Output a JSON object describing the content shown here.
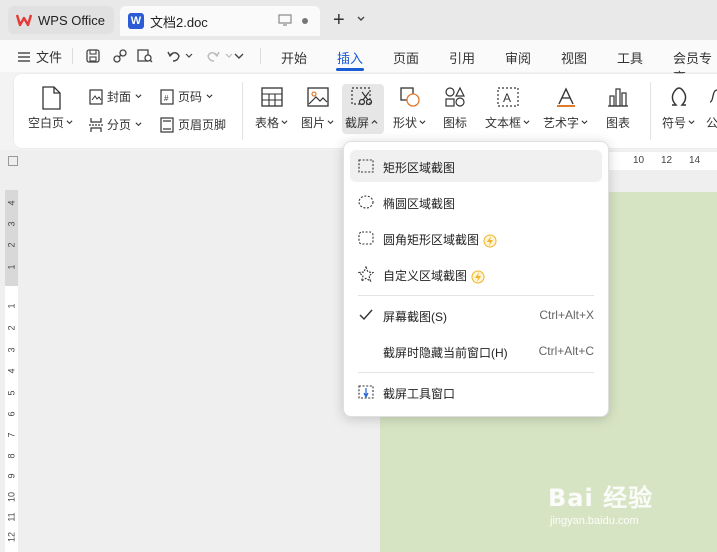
{
  "tabs": {
    "app_tab": "WPS Office",
    "doc_tab": "文档2.doc"
  },
  "menubar": {
    "file": "文件",
    "tabs": [
      "开始",
      "插入",
      "页面",
      "引用",
      "审阅",
      "视图",
      "工具",
      "会员专享"
    ],
    "active_tab": "插入"
  },
  "ribbon": {
    "blank_page": "空白页",
    "cover": "封面",
    "page_break": "分页",
    "page_number": "页码",
    "header_footer": "页眉页脚",
    "table": "表格",
    "picture": "图片",
    "screenshot": "截屏",
    "shape": "形状",
    "icon": "图标",
    "textbox": "文本框",
    "wordart": "艺术字",
    "chart": "图表",
    "symbol": "符号",
    "formula_partial": "公"
  },
  "ruler": {
    "top": [
      "10",
      "12",
      "14"
    ],
    "left_upper": [
      "4",
      "3",
      "2",
      "1"
    ],
    "left_lower": [
      "1",
      "2",
      "3",
      "4",
      "5",
      "6",
      "7",
      "8",
      "9",
      "10",
      "11",
      "12"
    ]
  },
  "dropdown": {
    "items": [
      {
        "label": "矩形区域截图"
      },
      {
        "label": "椭圆区域截图"
      },
      {
        "label": "圆角矩形区域截图"
      },
      {
        "label": "自定义区域截图"
      },
      {
        "label": "屏幕截图(S)",
        "shortcut": "Ctrl+Alt+X",
        "checked": true
      },
      {
        "label": "截屏时隐藏当前窗口(H)",
        "shortcut": "Ctrl+Alt+C"
      },
      {
        "label": "截屏工具窗口"
      }
    ]
  },
  "watermark": {
    "brand": "Bai 经验",
    "url": "jingyan.baidu.com"
  },
  "colors": {
    "accent": "#1a5bd6",
    "page_background": "#d7e4c4",
    "wps_red": "#e53935"
  }
}
